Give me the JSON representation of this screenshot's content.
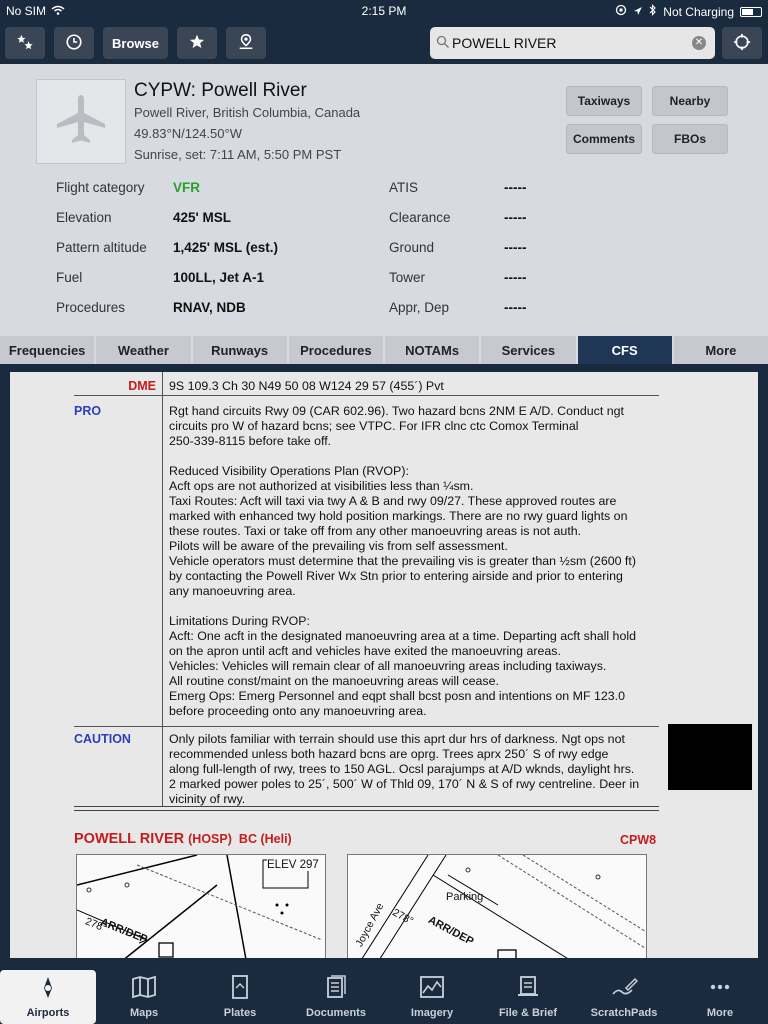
{
  "status_bar": {
    "carrier": "No SIM",
    "time": "2:15 PM",
    "charging": "Not Charging"
  },
  "toolbar": {
    "browse_label": "Browse",
    "search_value": "POWELL RIVER"
  },
  "airport": {
    "title": "CYPW: Powell River",
    "location": "Powell River, British Columbia, Canada",
    "coordinates": "49.83°N/124.50°W",
    "sun": "Sunrise, set: 7:11 AM, 5:50 PM PST",
    "buttons": {
      "taxiways": "Taxiways",
      "nearby": "Nearby",
      "comments": "Comments",
      "fbos": "FBOs"
    },
    "left_rows": [
      {
        "label": "Flight category",
        "value": "VFR"
      },
      {
        "label": "Elevation",
        "value": "425' MSL"
      },
      {
        "label": "Pattern altitude",
        "value": "1,425' MSL (est.)"
      },
      {
        "label": "Fuel",
        "value": "100LL, Jet A-1"
      },
      {
        "label": "Procedures",
        "value": "RNAV, NDB"
      }
    ],
    "right_rows": [
      {
        "label": "ATIS",
        "value": "-----"
      },
      {
        "label": "Clearance",
        "value": "-----"
      },
      {
        "label": "Ground",
        "value": "-----"
      },
      {
        "label": "Tower",
        "value": "-----"
      },
      {
        "label": "Appr, Dep",
        "value": "-----"
      }
    ]
  },
  "tabs": [
    "Frequencies",
    "Weather",
    "Runways",
    "Procedures",
    "NOTAMs",
    "Services",
    "CFS",
    "More"
  ],
  "cfs": {
    "dme_label": "DME",
    "dme_text": "9S   109.3   Ch 30    N49 50 08 W124 29 57   (455´)   Pvt",
    "pro_label": "PRO",
    "pro_lines": [
      "Rgt hand circuits Rwy 09 (CAR 602.96). Two hazard bcns 2NM E A/D. Conduct ngt",
      "circuits pro W of hazard bcns; see VTPC. For IFR clnc ctc Comox Terminal",
      "250-339-8115 before take off.",
      "",
      "Reduced Visibility Operations Plan (RVOP):",
      "Acft ops are not authorized at visibilities less than ¼sm.",
      "Taxi Routes: Acft will taxi via twy A & B and rwy 09/27. These approved routes are",
      "marked with enhanced twy hold position markings. There are no rwy guard lights on",
      "these routes. Taxi or take off from any other manoeuvring areas is not auth.",
      "Pilots will be aware of the prevailing vis from self assessment.",
      "Vehicle operators must determine that the prevailing vis is greater than ½sm (2600 ft)",
      "by contacting the Powell River Wx Stn prior to entering airside and prior to entering",
      "any manoeuvring area.",
      "",
      "Limitations During RVOP:",
      "Acft: One acft in the designated manoeuvring area at a time. Departing acft shall hold",
      "on the apron until acft and vehicles have exited the manoeuvring areas.",
      "Vehicles: Vehicles will remain clear of all manoeuvring areas including taxiways.",
      "All routine const/maint on the manoeuvring areas will cease.",
      "Emerg Ops: Emerg Personnel and eqpt shall bcst posn and intentions on MF 123.0",
      "before proceeding onto any manoeuvring area."
    ],
    "caution_label": "CAUTION",
    "caution_lines": [
      "Only pilots familiar with terrain should use this aprt dur hrs of darkness. Ngt ops not",
      "recommended unless both hazard bcns are oprg. Trees aprx 250´ S of rwy edge",
      "along full-length of rwy, trees to 150 AGL. Ocsl parajumps at A/D wknds, daylight hrs.",
      "2 marked power poles to 25´, 500´ W of Thld 09, 170´ N & S of rwy centreline. Deer in",
      "vicinity of rwy."
    ],
    "heli_title": "POWELL RIVER",
    "heli_hosp": "(HOSP)",
    "heli_bc": "BC (Heli)",
    "heli_code": "CPW8",
    "map1_elev": "ELEV 297",
    "map_arr": "ARR/DEP",
    "map_278": "278°",
    "map2_parking": "Parking",
    "map2_street": "Joyce Ave"
  },
  "bottom_tabs": [
    "Airports",
    "Maps",
    "Plates",
    "Documents",
    "Imagery",
    "File & Brief",
    "ScratchPads",
    "More"
  ]
}
